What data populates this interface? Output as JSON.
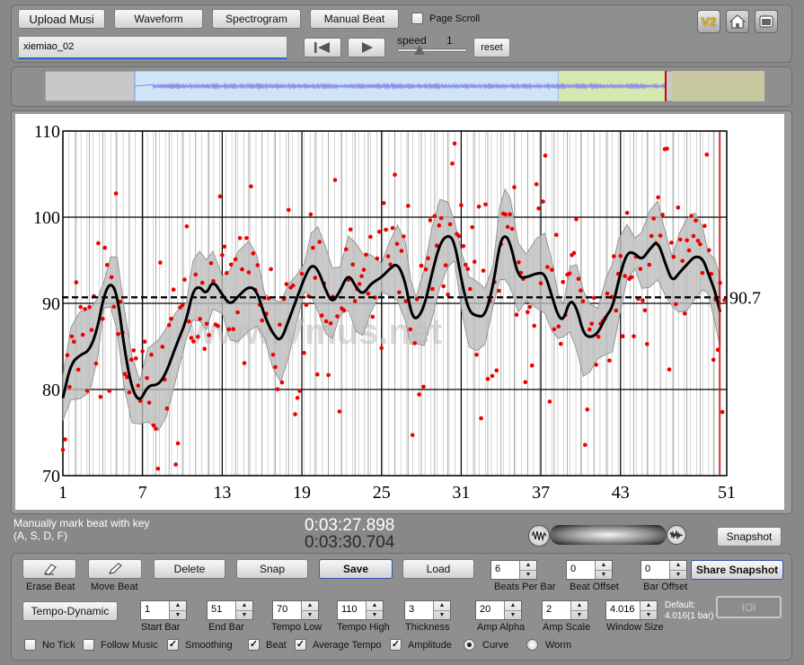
{
  "toolbar": {
    "upload_label": "Upload Musi",
    "waveform_label": "Waveform",
    "spectrogram_label": "Spectrogram",
    "manual_beat_label": "Manual Beat",
    "page_scroll_label": "Page Scroll",
    "v2_label": "V2",
    "file_name": "xiemiao_02",
    "speed_label": "speed",
    "speed_value": "1",
    "reset_label": "reset"
  },
  "chart_data": {
    "type": "line",
    "x_ticks": [
      "1",
      "7",
      "13",
      "19",
      "25",
      "31",
      "37",
      "43",
      "51"
    ],
    "y_ticks": [
      "70",
      "80",
      "90",
      "100",
      "110"
    ],
    "ylim": [
      70,
      110
    ],
    "xlim": [
      1,
      51
    ],
    "average_tempo": 90.7,
    "average_label": "90.7",
    "watermark": "www.Vmus.net",
    "curve": [
      [
        1,
        79
      ],
      [
        1.6,
        83
      ],
      [
        2.3,
        84
      ],
      [
        3,
        84.5
      ],
      [
        3.6,
        87
      ],
      [
        4.1,
        91
      ],
      [
        4.6,
        92.5
      ],
      [
        5.1,
        91
      ],
      [
        5.6,
        85
      ],
      [
        6.2,
        80
      ],
      [
        6.8,
        78.5
      ],
      [
        7.4,
        80.5
      ],
      [
        8.2,
        80.5
      ],
      [
        8.8,
        82
      ],
      [
        9.5,
        85
      ],
      [
        10.3,
        88
      ],
      [
        10.8,
        91.5
      ],
      [
        11.3,
        92
      ],
      [
        11.8,
        91
      ],
      [
        12.3,
        92.7
      ],
      [
        13,
        91
      ],
      [
        13.6,
        89.8
      ],
      [
        14.2,
        90.8
      ],
      [
        15,
        92
      ],
      [
        15.6,
        91.5
      ],
      [
        16.2,
        88.5
      ],
      [
        16.8,
        86.5
      ],
      [
        17.4,
        85.5
      ],
      [
        18,
        88
      ],
      [
        18.6,
        90.5
      ],
      [
        19.2,
        93
      ],
      [
        19.7,
        94.5
      ],
      [
        20.2,
        94
      ],
      [
        20.8,
        91.5
      ],
      [
        21.3,
        90
      ],
      [
        21.9,
        91.5
      ],
      [
        22.5,
        93.5
      ],
      [
        23.1,
        91.8
      ],
      [
        23.6,
        91
      ],
      [
        24.2,
        92.3
      ],
      [
        25,
        93
      ],
      [
        25.6,
        94
      ],
      [
        26.2,
        94.7
      ],
      [
        26.8,
        92.5
      ],
      [
        27.2,
        89
      ],
      [
        27.6,
        88
      ],
      [
        28.2,
        89.5
      ],
      [
        28.8,
        93.5
      ],
      [
        29.4,
        97
      ],
      [
        30,
        98
      ],
      [
        30.5,
        97.2
      ],
      [
        31.1,
        92
      ],
      [
        31.6,
        89
      ],
      [
        32.2,
        88.5
      ],
      [
        32.8,
        88.5
      ],
      [
        33.4,
        92
      ],
      [
        33.9,
        97
      ],
      [
        34.3,
        98
      ],
      [
        34.7,
        97
      ],
      [
        35.3,
        93
      ],
      [
        35.9,
        93
      ],
      [
        36.7,
        93.5
      ],
      [
        37.3,
        93.5
      ],
      [
        37.8,
        91
      ],
      [
        38.3,
        88.5
      ],
      [
        38.7,
        88
      ],
      [
        39.2,
        90.5
      ],
      [
        39.7,
        89.5
      ],
      [
        40.2,
        86.5
      ],
      [
        40.7,
        86
      ],
      [
        41.3,
        86.5
      ],
      [
        41.9,
        88.5
      ],
      [
        42.4,
        89.5
      ],
      [
        42.9,
        93
      ],
      [
        43.5,
        96
      ],
      [
        44.1,
        95.8
      ],
      [
        44.6,
        95
      ],
      [
        45.2,
        96.3
      ],
      [
        45.8,
        97.3
      ],
      [
        46.4,
        94.5
      ],
      [
        46.9,
        92.5
      ],
      [
        47.4,
        93.5
      ],
      [
        48,
        94.5
      ],
      [
        48.6,
        95.5
      ],
      [
        49.2,
        95.2
      ],
      [
        49.6,
        93.5
      ],
      [
        50.1,
        91.5
      ],
      [
        50.5,
        89
      ]
    ]
  },
  "status": {
    "hint_line1": "Manually mark beat with key",
    "hint_line2": "(A, S, D, F)",
    "time_current": "0:03:27.898",
    "time_total": "0:03:30.704",
    "snapshot_label": "Snapshot"
  },
  "controls": {
    "erase_beat_label": "Erase Beat",
    "move_beat_label": "Move Beat",
    "delete_label": "Delete",
    "snap_label": "Snap",
    "save_label": "Save",
    "load_label": "Load",
    "beats_per_bar_value": "6",
    "beats_per_bar_label": "Beats Per Bar",
    "beat_offset_value": "0",
    "beat_offset_label": "Beat Offset",
    "bar_offset_value": "0",
    "bar_offset_label": "Bar Offset",
    "share_snapshot_label": "Share Snapshot",
    "mode_label": "Tempo-Dynamic",
    "start_bar_value": "1",
    "start_bar_label": "Start Bar",
    "end_bar_value": "51",
    "end_bar_label": "End Bar",
    "tempo_low_value": "70",
    "tempo_low_label": "Tempo Low",
    "tempo_high_value": "110",
    "tempo_high_label": "Tempo High",
    "thickness_value": "3",
    "thickness_label": "Thickness",
    "amp_alpha_value": "20",
    "amp_alpha_label": "Amp Alpha",
    "amp_scale_value": "2",
    "amp_scale_label": "Amp Scale",
    "window_size_value": "4.016",
    "window_size_label": "Window Size",
    "default_line1": "Default:",
    "default_line2": "4.016(1 bar)",
    "ioi_label": "IOI",
    "no_tick_label": "No Tick",
    "follow_music_label": "Follow Music",
    "smoothing_label": "Smoothing",
    "beat_label": "Beat",
    "average_tempo_label": "Average Tempo",
    "amplitude_label": "Amplitude",
    "curve_label": "Curve",
    "worm_label": "Worm"
  }
}
